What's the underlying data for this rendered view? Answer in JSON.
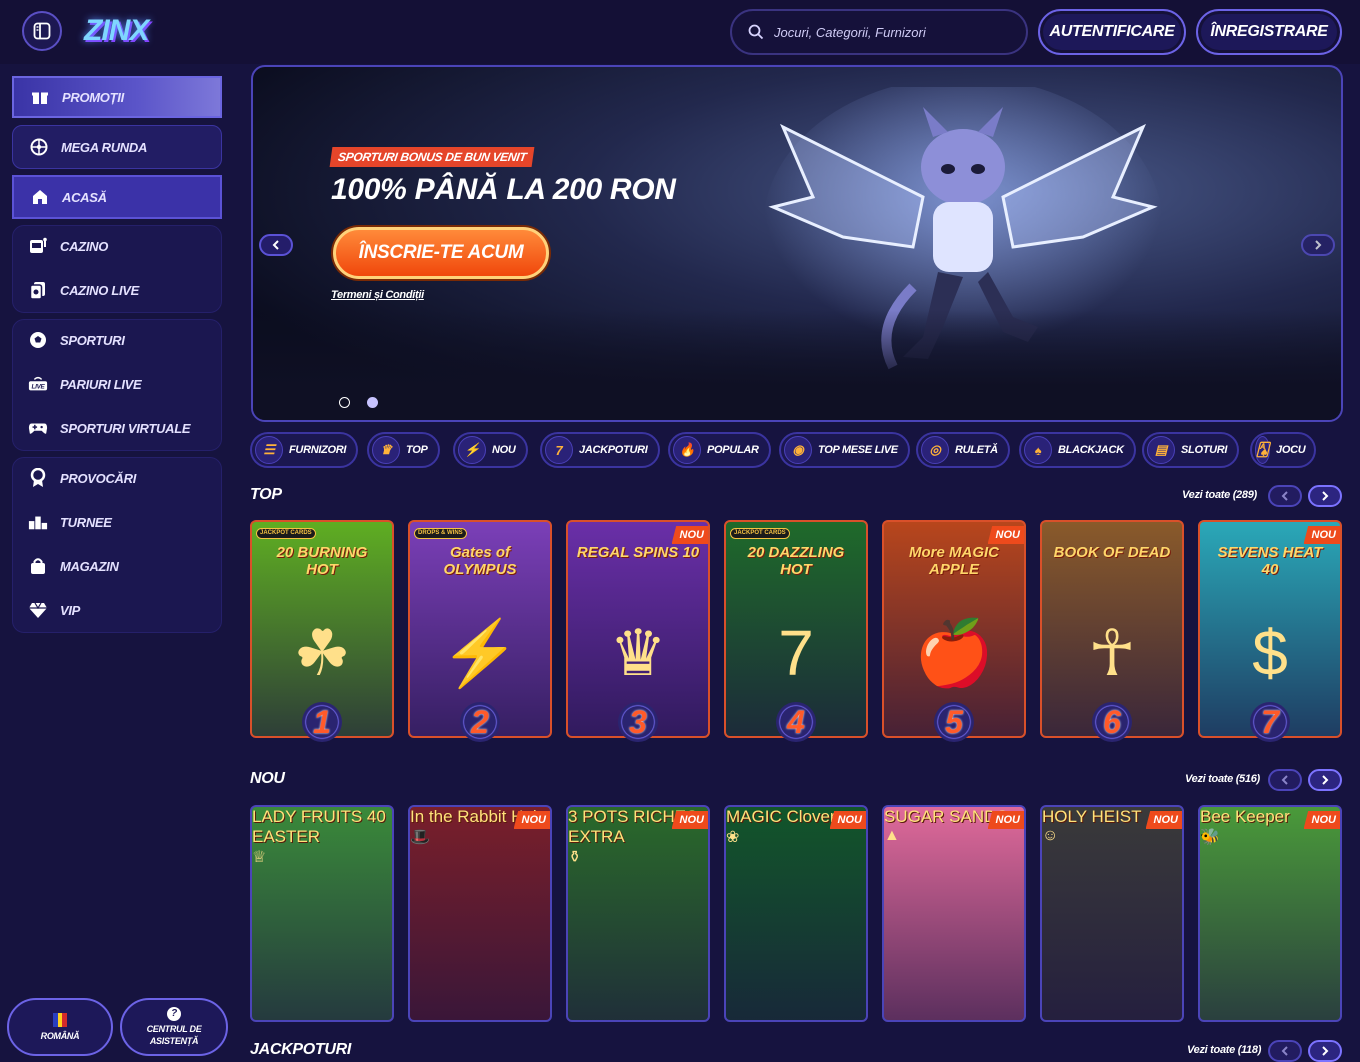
{
  "header": {
    "logo": "ZINX",
    "search_placeholder": "Jocuri, Categorii, Furnizori",
    "login_label": "AUTENTIFICARE",
    "register_label": "ÎNREGISTRARE"
  },
  "sidebar": {
    "items": [
      {
        "label": "PROMOȚII",
        "icon": "gift-icon"
      },
      {
        "label": "MEGA RUNDA",
        "icon": "wheel-icon"
      },
      {
        "label": "ACASĂ",
        "icon": "home-icon"
      },
      {
        "label": "CAZINO",
        "icon": "slot-machine-icon"
      },
      {
        "label": "CAZINO LIVE",
        "icon": "cards-icon"
      },
      {
        "label": "SPORTURI",
        "icon": "football-icon"
      },
      {
        "label": "PARIURI LIVE",
        "icon": "live-icon"
      },
      {
        "label": "SPORTURI VIRTUALE",
        "icon": "gamepad-icon"
      },
      {
        "label": "PROVOCĂRI",
        "icon": "medal-icon"
      },
      {
        "label": "TURNEE",
        "icon": "podium-icon"
      },
      {
        "label": "MAGAZIN",
        "icon": "bag-icon"
      },
      {
        "label": "VIP",
        "icon": "diamond-icon"
      }
    ],
    "language_label": "ROMÂNĂ",
    "support_label_1": "CENTRUL DE",
    "support_label_2": "ASISTENȚĂ"
  },
  "hero": {
    "badge": "SPORTURI BONUS DE BUN VENIT",
    "title": "100% PÂNĂ LA 200 RON",
    "cta_label": "ÎNSCRIE-TE ACUM",
    "terms_label": "Termeni și Condiții",
    "slides_total": 2,
    "active_slide": 2
  },
  "categories": [
    {
      "label": "FURNIZORI",
      "icon": "list-icon"
    },
    {
      "label": "TOP",
      "icon": "crown-icon"
    },
    {
      "label": "NOU",
      "icon": "lightning-icon"
    },
    {
      "label": "JACKPOTURI",
      "icon": "777-icon"
    },
    {
      "label": "POPULAR",
      "icon": "torch-icon"
    },
    {
      "label": "TOP MESE LIVE",
      "icon": "roulette-table-icon"
    },
    {
      "label": "RULETĂ",
      "icon": "roulette-icon"
    },
    {
      "label": "BLACKJACK",
      "icon": "blackjack-icon"
    },
    {
      "label": "SLOTURI",
      "icon": "slots-icon"
    },
    {
      "label": "JOCU",
      "icon": "cards-icon"
    }
  ],
  "top_section": {
    "title": "TOP",
    "see_all": "Vezi toate (289)",
    "games": [
      {
        "title": "20 BURNING HOT",
        "rank": "1",
        "tag": "",
        "jackpot": "JACKPOT CARDS",
        "bg": "#5fae22",
        "art": "☘"
      },
      {
        "title": "Gates of OLYMPUS",
        "rank": "2",
        "tag": "",
        "jackpot": "DROPS & WINS",
        "bg": "#7b3fb8",
        "art": "⚡"
      },
      {
        "title": "REGAL SPINS 10",
        "rank": "3",
        "tag": "NOU",
        "jackpot": "",
        "bg": "#6a2fa8",
        "art": "♛"
      },
      {
        "title": "20 DAZZLING HOT",
        "rank": "4",
        "tag": "",
        "jackpot": "JACKPOT CARDS",
        "bg": "#1f6a2a",
        "art": "7"
      },
      {
        "title": "More MAGIC APPLE",
        "rank": "5",
        "tag": "NOU",
        "jackpot": "",
        "bg": "#b8461c",
        "art": "🍎"
      },
      {
        "title": "BOOK OF DEAD",
        "rank": "6",
        "tag": "",
        "jackpot": "",
        "bg": "#8a5a2a",
        "art": "☥"
      },
      {
        "title": "SEVENS HEAT 40",
        "rank": "7",
        "tag": "NOU",
        "jackpot": "",
        "bg": "#2aa8b8",
        "art": "$"
      }
    ]
  },
  "new_section": {
    "title": "NOU",
    "see_all": "Vezi toate (516)",
    "games": [
      {
        "title": "LADY FRUITS 40 EASTER",
        "tag": "",
        "bg": "#3a8a3a",
        "art": "♕"
      },
      {
        "title": "In the Rabbit Hole",
        "tag": "NOU",
        "bg": "#7a1f2a",
        "art": "🎩"
      },
      {
        "title": "3 POTS RICHES EXTRA",
        "tag": "NOU",
        "bg": "#2a6a2a",
        "art": "⚱"
      },
      {
        "title": "MAGIC Clovers",
        "tag": "NOU",
        "bg": "#12562a",
        "art": "❀"
      },
      {
        "title": "SUGAR SANDS",
        "tag": "NOU",
        "bg": "#e06a9a",
        "art": "▲"
      },
      {
        "title": "HOLY HEIST",
        "tag": "NOU",
        "bg": "#3a3a3a",
        "art": "☺"
      },
      {
        "title": "Bee Keeper",
        "tag": "NOU",
        "bg": "#4a9a3a",
        "art": "🐝"
      }
    ]
  },
  "jackpot_section": {
    "title": "JACKPOTURI",
    "see_all": "Vezi toate (118)"
  },
  "colors": {
    "background": "#16133f",
    "accent": "#6c63e6",
    "orange": "#f0470c"
  }
}
